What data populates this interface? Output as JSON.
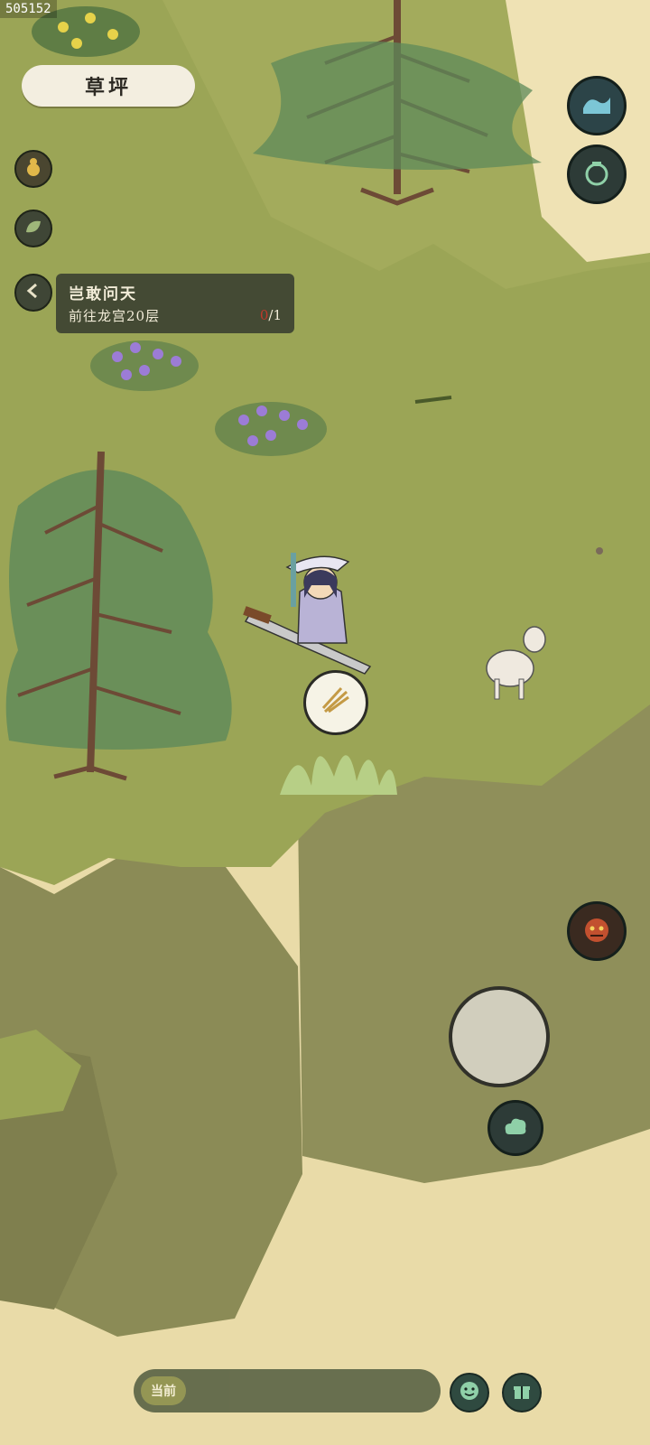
{
  "debug_id": "505152",
  "location": {
    "name": "草坪"
  },
  "quest": {
    "title": "岂敢问天",
    "description": "前往龙宫20层",
    "progress_current": "0",
    "progress_total": "/1"
  },
  "left_buttons": [
    {
      "icon": "gourd-icon"
    },
    {
      "icon": "leaf-icon"
    },
    {
      "icon": "chevron-left-icon"
    }
  ],
  "right_buttons": [
    {
      "icon": "wave-icon"
    },
    {
      "icon": "jar-icon"
    },
    {
      "icon": "demon-mask-icon"
    },
    {
      "icon": "cloud-icon"
    }
  ],
  "bubble": {
    "icon": "wheat-icon"
  },
  "chat": {
    "channel": "当前"
  },
  "bottom_buttons": [
    {
      "icon": "smiley-icon"
    },
    {
      "icon": "gift-icon"
    }
  ],
  "colors": {
    "grass": "#9aa655",
    "cliff": "#8d8d58",
    "sky": "#e8d9a6",
    "panel": "#383e30"
  }
}
